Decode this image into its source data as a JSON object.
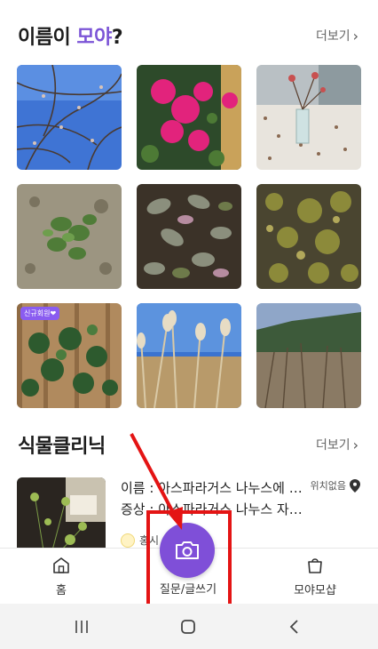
{
  "names_section": {
    "title_prefix": "이름이 ",
    "title_accent": "모야",
    "title_suffix": "?",
    "more_label": "더보기",
    "new_member_badge": "신규회원❤"
  },
  "clinic_section": {
    "title": "식물클리닉",
    "more_label": "더보기",
    "post": {
      "name_line": "이름 : 아스파라거스 나누스에 …",
      "symptom_line": "증상 : 아스파라거스 나누스 자…",
      "location": "위치없음",
      "author": "홍시"
    }
  },
  "bottom_nav": {
    "home_label": "홈",
    "ask_label": "질문/글쓰기",
    "shop_label": "모야모샵"
  },
  "colors": {
    "accent": "#7b54d6",
    "fab": "#7f4fd8",
    "highlight": "#e41414"
  }
}
